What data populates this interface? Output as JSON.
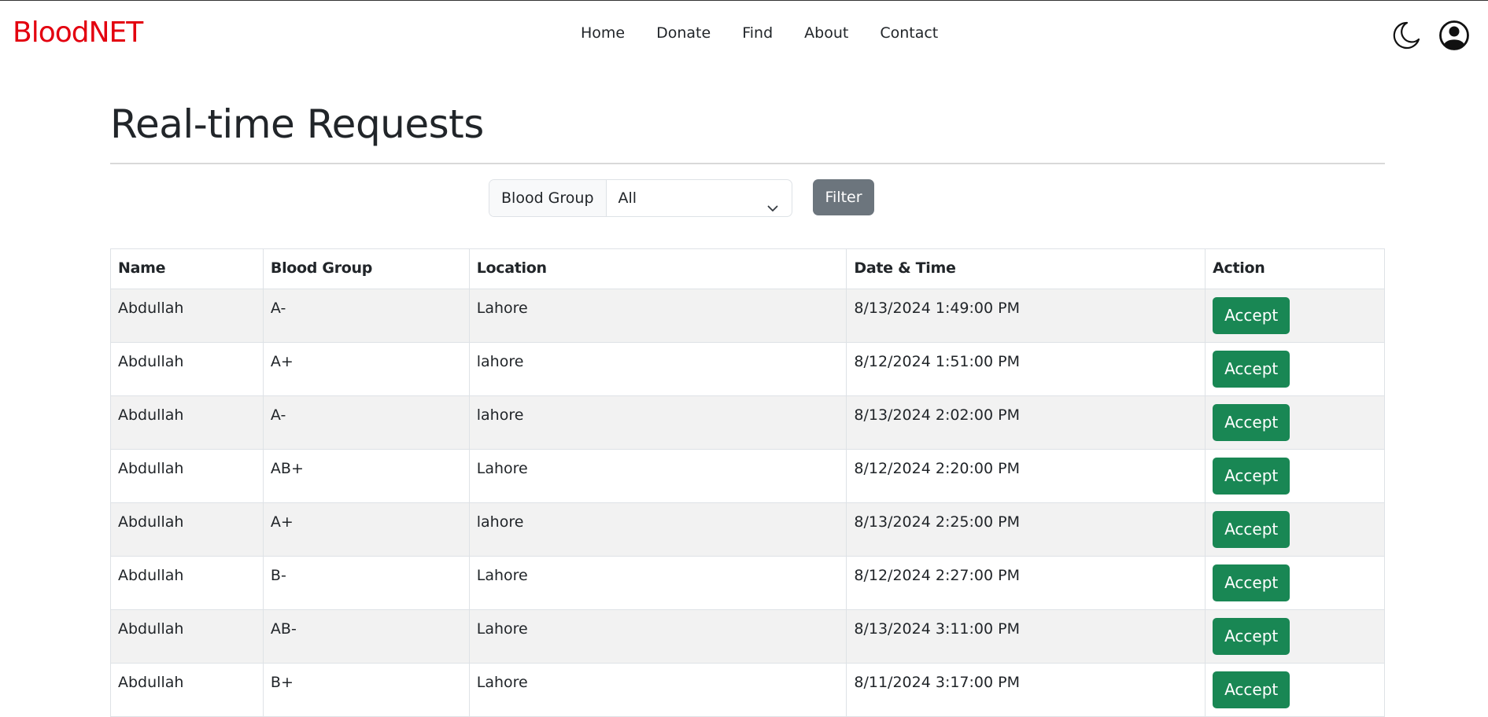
{
  "brand": "BloodNET",
  "nav": [
    "Home",
    "Donate",
    "Find",
    "About",
    "Contact"
  ],
  "header_icons": [
    "moon-icon",
    "user-circle-icon"
  ],
  "page": {
    "title": "Real-time Requests"
  },
  "filter": {
    "label": "Blood Group",
    "selected": "All",
    "button": "Filter"
  },
  "table": {
    "columns": [
      "Name",
      "Blood Group",
      "Location",
      "Date & Time",
      "Action"
    ],
    "rows": [
      {
        "name": "Abdullah",
        "blood_group": "A-",
        "location": "Lahore",
        "datetime": "8/13/2024 1:49:00 PM",
        "action": "Accept"
      },
      {
        "name": "Abdullah",
        "blood_group": "A+",
        "location": "lahore",
        "datetime": "8/12/2024 1:51:00 PM",
        "action": "Accept"
      },
      {
        "name": "Abdullah",
        "blood_group": "A-",
        "location": "lahore",
        "datetime": "8/13/2024 2:02:00 PM",
        "action": "Accept"
      },
      {
        "name": "Abdullah",
        "blood_group": "AB+",
        "location": "Lahore",
        "datetime": "8/12/2024 2:20:00 PM",
        "action": "Accept"
      },
      {
        "name": "Abdullah",
        "blood_group": "A+",
        "location": "lahore",
        "datetime": "8/13/2024 2:25:00 PM",
        "action": "Accept"
      },
      {
        "name": "Abdullah",
        "blood_group": "B-",
        "location": "Lahore",
        "datetime": "8/12/2024 2:27:00 PM",
        "action": "Accept"
      },
      {
        "name": "Abdullah",
        "blood_group": "AB-",
        "location": "Lahore",
        "datetime": "8/13/2024 3:11:00 PM",
        "action": "Accept"
      },
      {
        "name": "Abdullah",
        "blood_group": "B+",
        "location": "Lahore",
        "datetime": "8/11/2024 3:17:00 PM",
        "action": "Accept"
      }
    ]
  },
  "colors": {
    "brand": "#e3000f",
    "accept": "#198754",
    "filter_button": "#6c757d"
  }
}
